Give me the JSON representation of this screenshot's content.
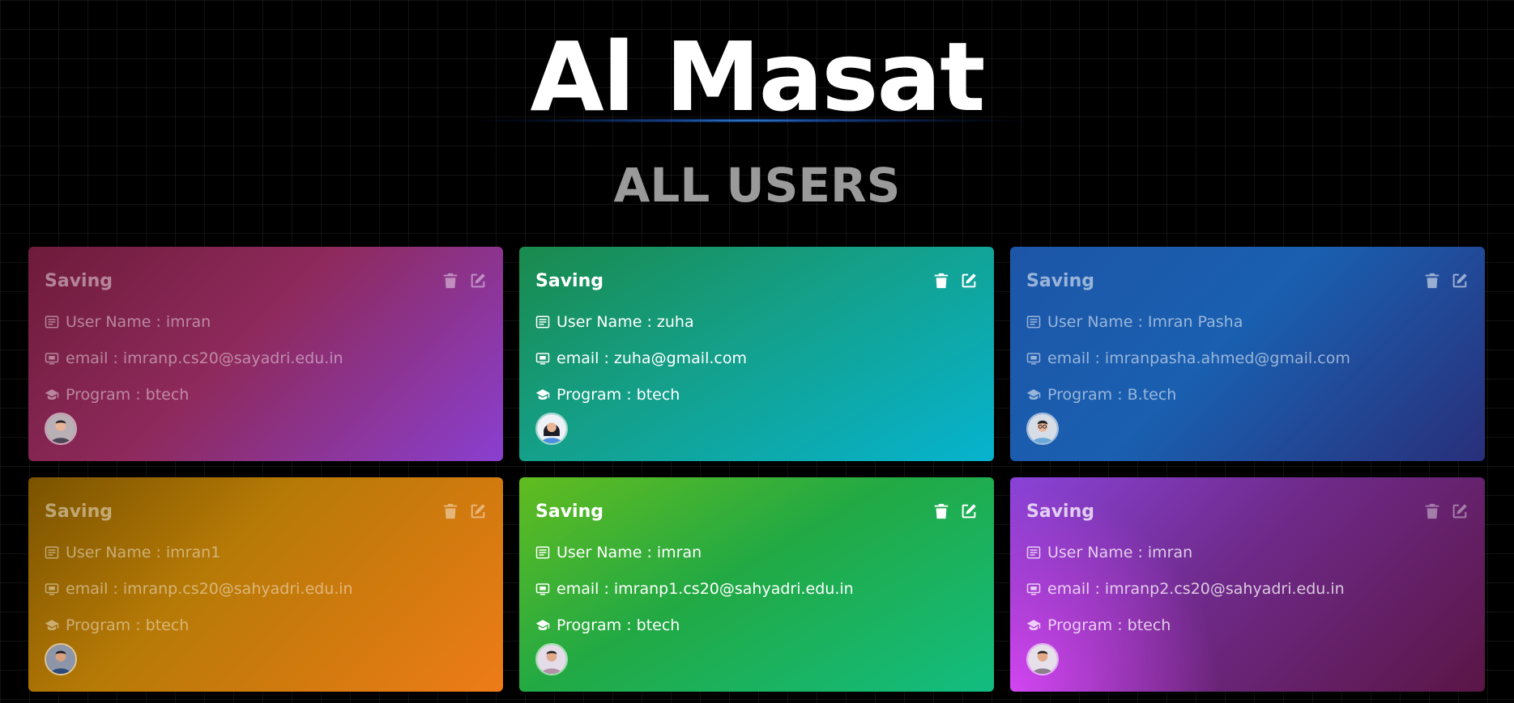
{
  "header": {
    "brand": "Al Masat",
    "subtitle": "ALL USERS"
  },
  "theme": {
    "background": "#000000",
    "title_color": "#ffffff",
    "subtitle_color": "#9a9a9a",
    "glow_color": "#3caaff"
  },
  "cards": [
    {
      "title": "Saving",
      "username": "User Name : imran",
      "email": "email : imranp.cs20@sayadri.edu.in",
      "program": "Program : btech",
      "colors": [
        "#6e1b3a",
        "#8a3fd0"
      ],
      "avatar": "male-avatar"
    },
    {
      "title": "Saving",
      "username": "User Name : zuha",
      "email": "email : zuha@gmail.com",
      "program": "Program : btech",
      "colors": [
        "#1a8a4c",
        "#06b3cf"
      ],
      "avatar": "female-avatar"
    },
    {
      "title": "Saving",
      "username": "User Name : Imran Pasha",
      "email": "email : imranpasha.ahmed@gmail.com",
      "program": "Program : B.tech",
      "colors": [
        "#1d56a8",
        "#292f7a"
      ],
      "avatar": "male-glasses-avatar"
    },
    {
      "title": "Saving",
      "username": "User Name : imran1",
      "email": "email : imranp.cs20@sahyadri.edu.in",
      "program": "Program : btech",
      "colors": [
        "#7a5300",
        "#ee7b18"
      ],
      "avatar": "male-avatar"
    },
    {
      "title": "Saving",
      "username": "User Name : imran",
      "email": "email : imranp1.cs20@sahyadri.edu.in",
      "program": "Program : btech",
      "colors": [
        "#62bc1f",
        "#12bd80"
      ],
      "avatar": "male-avatar"
    },
    {
      "title": "Saving",
      "username": "User Name : imran",
      "email": "email : imranp2.cs20@sahyadri.edu.in",
      "program": "Program : btech",
      "colors": [
        "#8a43d8",
        "#5a1645"
      ],
      "avatar": "male-avatar"
    }
  ],
  "icons": {
    "delete": "trash-icon",
    "edit": "edit-icon",
    "username": "list-icon",
    "email": "id-card-icon",
    "program": "graduation-cap-icon"
  }
}
